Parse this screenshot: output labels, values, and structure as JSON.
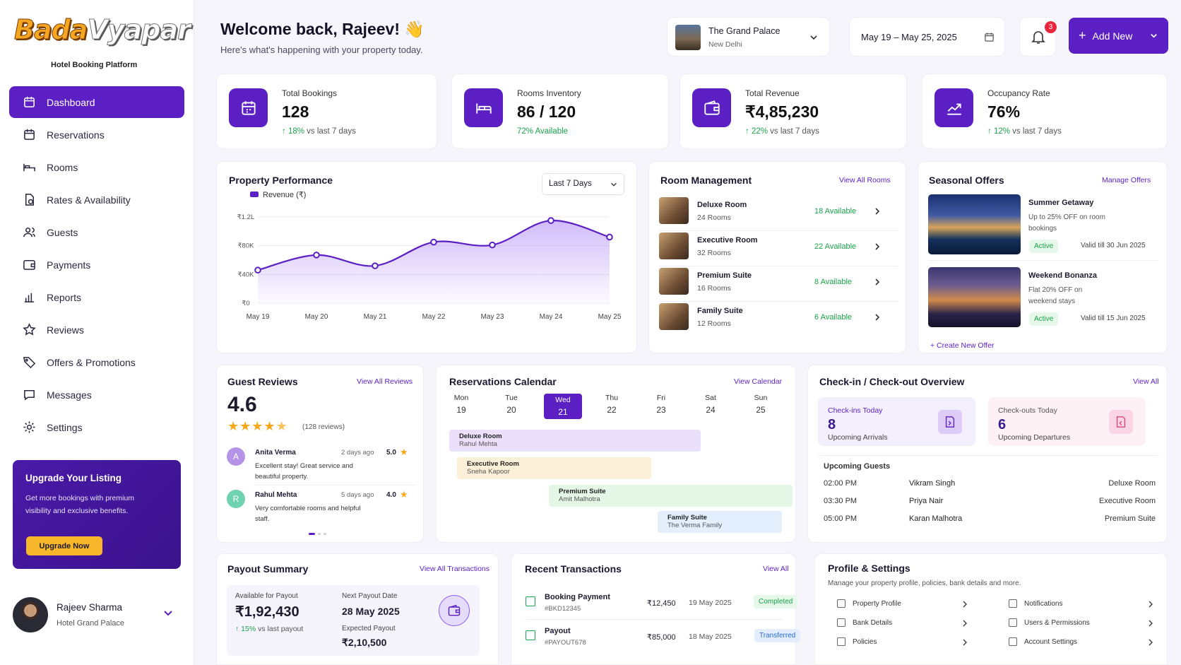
{
  "brand": {
    "logo_part1": "Bada",
    "logo_part2": "Vyapar",
    "tagline": "Hotel Booking Platform"
  },
  "nav": [
    {
      "label": "Dashboard",
      "icon": "dashboard-icon",
      "active": true
    },
    {
      "label": "Reservations",
      "icon": "calendar-icon"
    },
    {
      "label": "Rooms",
      "icon": "bed-icon"
    },
    {
      "label": "Rates & Availability",
      "icon": "rates-icon"
    },
    {
      "label": "Guests",
      "icon": "users-icon"
    },
    {
      "label": "Payments",
      "icon": "wallet-icon"
    },
    {
      "label": "Reports",
      "icon": "bar-chart-icon"
    },
    {
      "label": "Reviews",
      "icon": "star-icon"
    },
    {
      "label": "Offers & Promotions",
      "icon": "tag-icon"
    },
    {
      "label": "Messages",
      "icon": "message-icon"
    },
    {
      "label": "Settings",
      "icon": "gear-icon"
    }
  ],
  "upgrade": {
    "title": "Upgrade Your Listing",
    "text": "Get more bookings with premium visibility and exclusive benefits.",
    "button": "Upgrade Now"
  },
  "user": {
    "name": "Rajeev Sharma",
    "property": "Hotel Grand Palace"
  },
  "header": {
    "title": "Welcome back, Rajeev! 👋",
    "subtitle": "Here's what's happening with your property today."
  },
  "property_selector": {
    "name": "The Grand Palace",
    "city": "New Delhi"
  },
  "date_range": "May 19 – May 25, 2025",
  "notifications_count": "3",
  "add_new": "Add New",
  "stats": [
    {
      "label": "Total Bookings",
      "value": "128",
      "change": "↑ 18%",
      "suffix": " vs last 7 days"
    },
    {
      "label": "Rooms Inventory",
      "value": "86 / 120",
      "change": "72% Available",
      "suffix": ""
    },
    {
      "label": "Total Revenue",
      "value": "₹4,85,230",
      "change": "↑ 22%",
      "suffix": " vs last 7 days"
    },
    {
      "label": "Occupancy Rate",
      "value": "76%",
      "change": "↑ 12%",
      "suffix": " vs last 7 days"
    }
  ],
  "performance": {
    "title": "Property Performance",
    "range": "Last 7 Days"
  },
  "chart_data": {
    "type": "area",
    "legend": [
      "Revenue (₹)"
    ],
    "x": [
      "May 19",
      "May 20",
      "May 21",
      "May 22",
      "May 23",
      "May 24",
      "May 25"
    ],
    "y_ticks": [
      "₹0",
      "₹40K",
      "₹80K",
      "₹1.2L"
    ],
    "ylim": [
      0,
      120000
    ],
    "series": [
      {
        "name": "Revenue (₹)",
        "values": [
          46000,
          67000,
          52000,
          85000,
          81000,
          115000,
          92000
        ]
      }
    ],
    "color": "#5b1fc4"
  },
  "rooms": {
    "title": "Room Management",
    "link": "View All Rooms",
    "items": [
      {
        "name": "Deluxe Room",
        "count": "24 Rooms",
        "avail": "18 Available"
      },
      {
        "name": "Executive Room",
        "count": "32 Rooms",
        "avail": "22 Available"
      },
      {
        "name": "Premium Suite",
        "count": "16 Rooms",
        "avail": "8 Available"
      },
      {
        "name": "Family Suite",
        "count": "12 Rooms",
        "avail": "6 Available"
      }
    ]
  },
  "offers": {
    "title": "Seasonal Offers",
    "link": "Manage Offers",
    "create": "+ Create New Offer",
    "items": [
      {
        "title": "Summer Getaway",
        "desc": "Up to 25% OFF on room bookings",
        "status": "Active",
        "valid": "Valid till 30 Jun 2025"
      },
      {
        "title": "Weekend Bonanza",
        "desc": "Flat 20% OFF on weekend stays",
        "status": "Active",
        "valid": "Valid till 15 Jun 2025"
      }
    ]
  },
  "reviews": {
    "title": "Guest Reviews",
    "link": "View All Reviews",
    "rating": "4.6",
    "count": "(128 reviews)",
    "items": [
      {
        "initial": "A",
        "name": "Anita Verma",
        "when": "2 days ago",
        "score": "5.0",
        "text": "Excellent stay! Great service and beautiful property."
      },
      {
        "initial": "R",
        "name": "Rahul Mehta",
        "when": "5 days ago",
        "score": "4.0",
        "text": "Very comfortable rooms and helpful staff."
      }
    ]
  },
  "calendar": {
    "title": "Reservations Calendar",
    "link": "View Calendar",
    "days": [
      {
        "d": "Mon",
        "n": "19"
      },
      {
        "d": "Tue",
        "n": "20"
      },
      {
        "d": "Wed",
        "n": "21"
      },
      {
        "d": "Thu",
        "n": "22"
      },
      {
        "d": "Fri",
        "n": "23"
      },
      {
        "d": "Sat",
        "n": "24"
      },
      {
        "d": "Sun",
        "n": "25"
      }
    ],
    "bookings": [
      {
        "room": "Deluxe Room",
        "guest": "Rahul Mehta"
      },
      {
        "room": "Executive Room",
        "guest": "Sneha Kapoor"
      },
      {
        "room": "Premium Suite",
        "guest": "Amit Malhotra"
      },
      {
        "room": "Family Suite",
        "guest": "The Verma Family"
      }
    ]
  },
  "checkin": {
    "title": "Check-in / Check-out Overview",
    "link": "View All",
    "in_label": "Check-ins Today",
    "in_value": "8",
    "in_sub": "Upcoming Arrivals",
    "out_label": "Check-outs Today",
    "out_value": "6",
    "out_sub": "Upcoming Departures",
    "upcoming_title": "Upcoming Guests",
    "guests": [
      {
        "time": "02:00 PM",
        "name": "Vikram Singh",
        "room": "Deluxe Room"
      },
      {
        "time": "03:30 PM",
        "name": "Priya Nair",
        "room": "Executive Room"
      },
      {
        "time": "05:00 PM",
        "name": "Karan Malhotra",
        "room": "Premium Suite"
      }
    ]
  },
  "payout": {
    "title": "Payout Summary",
    "link": "View All Transactions",
    "avail_label": "Available for Payout",
    "avail_value": "₹1,92,430",
    "change": "↑ 15%",
    "change_suffix": " vs last payout",
    "next_label": "Next Payout Date",
    "next_value": "28 May 2025",
    "expected_label": "Expected Payout",
    "expected_value": "₹2,10,500"
  },
  "transactions": {
    "title": "Recent Transactions",
    "link": "View All",
    "items": [
      {
        "name": "Booking Payment",
        "id": "#BKD12345",
        "amount": "₹12,450",
        "date": "19 May 2025",
        "status": "Completed"
      },
      {
        "name": "Payout",
        "id": "#PAYOUT678",
        "amount": "₹85,000",
        "date": "18 May 2025",
        "status": "Transferred"
      }
    ]
  },
  "profile_settings": {
    "title": "Profile & Settings",
    "subtitle": "Manage your property profile, policies, bank details and more.",
    "items": [
      "Property Profile",
      "Notifications",
      "Bank Details",
      "Users & Permissions",
      "Policies",
      "Account Settings"
    ]
  }
}
